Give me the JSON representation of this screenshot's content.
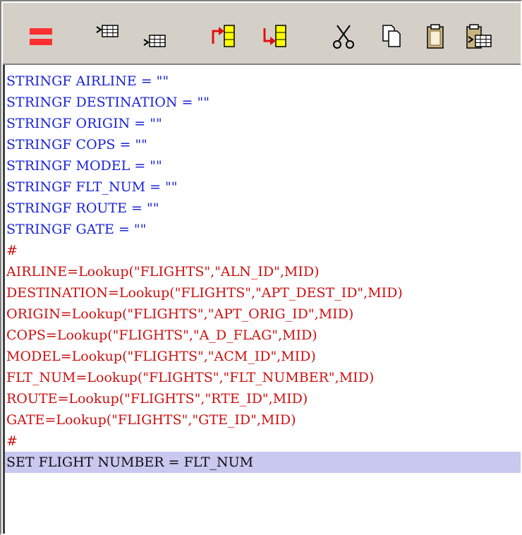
{
  "toolbar": {
    "buttons": [
      {
        "name": "equals-icon"
      },
      {
        "name": "insert-row-above-icon"
      },
      {
        "name": "insert-row-below-icon"
      },
      {
        "name": "move-up-icon"
      },
      {
        "name": "move-down-icon"
      },
      {
        "name": "cut-icon"
      },
      {
        "name": "copy-icon"
      },
      {
        "name": "paste-icon"
      },
      {
        "name": "paste-table-icon"
      }
    ]
  },
  "colors": {
    "declaration": "#1a23d6",
    "lookup": "#cc1010",
    "current_line_bg": "#c8c8f0"
  },
  "editor": {
    "lines": [
      "STRINGF AIRLINE = \"\"",
      "STRINGF DESTINATION = \"\"",
      "STRINGF ORIGIN = \"\"",
      "STRINGF COPS = \"\"",
      "STRINGF MODEL = \"\"",
      "STRINGF FLT_NUM = \"\"",
      "STRINGF ROUTE = \"\"",
      "STRINGF GATE = \"\"",
      "#",
      "AIRLINE=Lookup(\"FLIGHTS\",\"ALN_ID\",MID)",
      "DESTINATION=Lookup(\"FLIGHTS\",\"APT_DEST_ID\",MID)",
      "ORIGIN=Lookup(\"FLIGHTS\",\"APT_ORIG_ID\",MID)",
      "COPS=Lookup(\"FLIGHTS\",\"A_D_FLAG\",MID)",
      "MODEL=Lookup(\"FLIGHTS\",\"ACM_ID\",MID)",
      "FLT_NUM=Lookup(\"FLIGHTS\",\"FLT_NUMBER\",MID)",
      "ROUTE=Lookup(\"FLIGHTS\",\"RTE_ID\",MID)",
      "GATE=Lookup(\"FLIGHTS\",\"GTE_ID\",MID)",
      "#",
      "SET FLIGHT NUMBER = FLT_NUM"
    ]
  }
}
